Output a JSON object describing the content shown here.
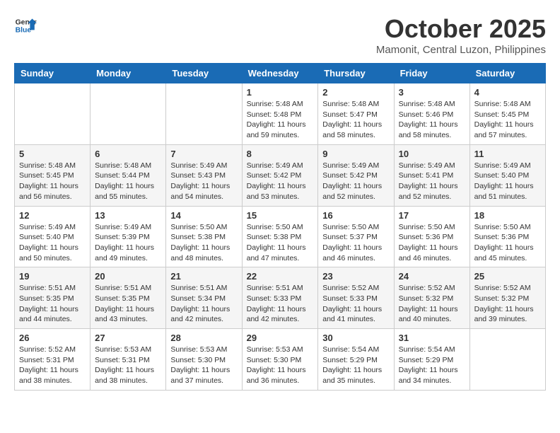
{
  "header": {
    "logo_general": "General",
    "logo_blue": "Blue",
    "month_title": "October 2025",
    "location": "Mamonit, Central Luzon, Philippines"
  },
  "weekdays": [
    "Sunday",
    "Monday",
    "Tuesday",
    "Wednesday",
    "Thursday",
    "Friday",
    "Saturday"
  ],
  "weeks": [
    [
      {
        "day": "",
        "info": ""
      },
      {
        "day": "",
        "info": ""
      },
      {
        "day": "",
        "info": ""
      },
      {
        "day": "1",
        "info": "Sunrise: 5:48 AM\nSunset: 5:48 PM\nDaylight: 11 hours\nand 59 minutes."
      },
      {
        "day": "2",
        "info": "Sunrise: 5:48 AM\nSunset: 5:47 PM\nDaylight: 11 hours\nand 58 minutes."
      },
      {
        "day": "3",
        "info": "Sunrise: 5:48 AM\nSunset: 5:46 PM\nDaylight: 11 hours\nand 58 minutes."
      },
      {
        "day": "4",
        "info": "Sunrise: 5:48 AM\nSunset: 5:45 PM\nDaylight: 11 hours\nand 57 minutes."
      }
    ],
    [
      {
        "day": "5",
        "info": "Sunrise: 5:48 AM\nSunset: 5:45 PM\nDaylight: 11 hours\nand 56 minutes."
      },
      {
        "day": "6",
        "info": "Sunrise: 5:48 AM\nSunset: 5:44 PM\nDaylight: 11 hours\nand 55 minutes."
      },
      {
        "day": "7",
        "info": "Sunrise: 5:49 AM\nSunset: 5:43 PM\nDaylight: 11 hours\nand 54 minutes."
      },
      {
        "day": "8",
        "info": "Sunrise: 5:49 AM\nSunset: 5:42 PM\nDaylight: 11 hours\nand 53 minutes."
      },
      {
        "day": "9",
        "info": "Sunrise: 5:49 AM\nSunset: 5:42 PM\nDaylight: 11 hours\nand 52 minutes."
      },
      {
        "day": "10",
        "info": "Sunrise: 5:49 AM\nSunset: 5:41 PM\nDaylight: 11 hours\nand 52 minutes."
      },
      {
        "day": "11",
        "info": "Sunrise: 5:49 AM\nSunset: 5:40 PM\nDaylight: 11 hours\nand 51 minutes."
      }
    ],
    [
      {
        "day": "12",
        "info": "Sunrise: 5:49 AM\nSunset: 5:40 PM\nDaylight: 11 hours\nand 50 minutes."
      },
      {
        "day": "13",
        "info": "Sunrise: 5:49 AM\nSunset: 5:39 PM\nDaylight: 11 hours\nand 49 minutes."
      },
      {
        "day": "14",
        "info": "Sunrise: 5:50 AM\nSunset: 5:38 PM\nDaylight: 11 hours\nand 48 minutes."
      },
      {
        "day": "15",
        "info": "Sunrise: 5:50 AM\nSunset: 5:38 PM\nDaylight: 11 hours\nand 47 minutes."
      },
      {
        "day": "16",
        "info": "Sunrise: 5:50 AM\nSunset: 5:37 PM\nDaylight: 11 hours\nand 46 minutes."
      },
      {
        "day": "17",
        "info": "Sunrise: 5:50 AM\nSunset: 5:36 PM\nDaylight: 11 hours\nand 46 minutes."
      },
      {
        "day": "18",
        "info": "Sunrise: 5:50 AM\nSunset: 5:36 PM\nDaylight: 11 hours\nand 45 minutes."
      }
    ],
    [
      {
        "day": "19",
        "info": "Sunrise: 5:51 AM\nSunset: 5:35 PM\nDaylight: 11 hours\nand 44 minutes."
      },
      {
        "day": "20",
        "info": "Sunrise: 5:51 AM\nSunset: 5:35 PM\nDaylight: 11 hours\nand 43 minutes."
      },
      {
        "day": "21",
        "info": "Sunrise: 5:51 AM\nSunset: 5:34 PM\nDaylight: 11 hours\nand 42 minutes."
      },
      {
        "day": "22",
        "info": "Sunrise: 5:51 AM\nSunset: 5:33 PM\nDaylight: 11 hours\nand 42 minutes."
      },
      {
        "day": "23",
        "info": "Sunrise: 5:52 AM\nSunset: 5:33 PM\nDaylight: 11 hours\nand 41 minutes."
      },
      {
        "day": "24",
        "info": "Sunrise: 5:52 AM\nSunset: 5:32 PM\nDaylight: 11 hours\nand 40 minutes."
      },
      {
        "day": "25",
        "info": "Sunrise: 5:52 AM\nSunset: 5:32 PM\nDaylight: 11 hours\nand 39 minutes."
      }
    ],
    [
      {
        "day": "26",
        "info": "Sunrise: 5:52 AM\nSunset: 5:31 PM\nDaylight: 11 hours\nand 38 minutes."
      },
      {
        "day": "27",
        "info": "Sunrise: 5:53 AM\nSunset: 5:31 PM\nDaylight: 11 hours\nand 38 minutes."
      },
      {
        "day": "28",
        "info": "Sunrise: 5:53 AM\nSunset: 5:30 PM\nDaylight: 11 hours\nand 37 minutes."
      },
      {
        "day": "29",
        "info": "Sunrise: 5:53 AM\nSunset: 5:30 PM\nDaylight: 11 hours\nand 36 minutes."
      },
      {
        "day": "30",
        "info": "Sunrise: 5:54 AM\nSunset: 5:29 PM\nDaylight: 11 hours\nand 35 minutes."
      },
      {
        "day": "31",
        "info": "Sunrise: 5:54 AM\nSunset: 5:29 PM\nDaylight: 11 hours\nand 34 minutes."
      },
      {
        "day": "",
        "info": ""
      }
    ]
  ]
}
